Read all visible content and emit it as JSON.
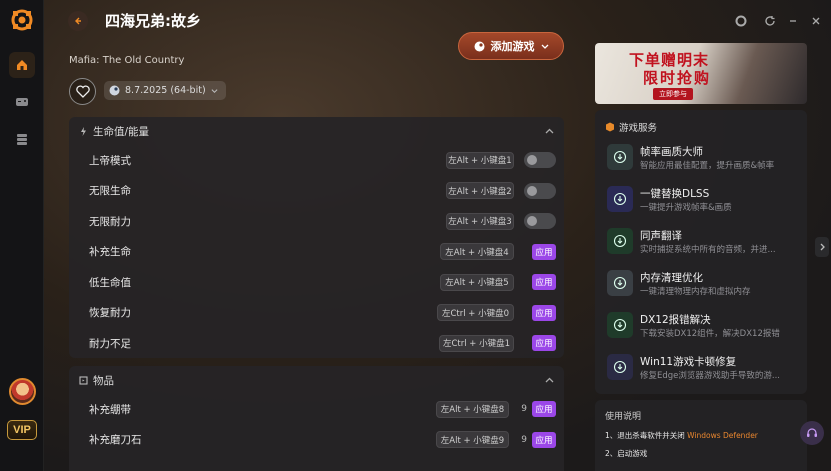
{
  "app": {
    "game_title": "四海兄弟:故乡",
    "game_subtitle": "Mafia: The Old Country",
    "add_game_label": "添加游戏",
    "version": "8.7.2025 (64-bit)",
    "vip_label": "VIP"
  },
  "cheats": {
    "section1_title": "生命值/能量",
    "section2_title": "物品",
    "apply_label": "应用",
    "rows": [
      {
        "label": "上帝模式",
        "hotkey": "左Alt + 小键盘1",
        "control": "toggle"
      },
      {
        "label": "无限生命",
        "hotkey": "左Alt + 小键盘2",
        "control": "toggle"
      },
      {
        "label": "无限耐力",
        "hotkey": "左Alt + 小键盘3",
        "control": "toggle"
      },
      {
        "label": "补充生命",
        "hotkey": "左Alt + 小键盘4",
        "control": "apply"
      },
      {
        "label": "低生命值",
        "hotkey": "左Alt + 小键盘5",
        "control": "apply"
      },
      {
        "label": "恢复耐力",
        "hotkey": "左Ctrl + 小键盘0",
        "control": "apply"
      },
      {
        "label": "耐力不足",
        "hotkey": "左Ctrl + 小键盘1",
        "control": "apply"
      }
    ],
    "items": [
      {
        "label": "补充绷带",
        "hotkey": "左Alt + 小键盘8",
        "count": "9",
        "control": "apply"
      },
      {
        "label": "补充磨刀石",
        "hotkey": "左Alt + 小键盘9",
        "count": "9",
        "control": "apply"
      }
    ]
  },
  "banner": {
    "line1": "下单赠明末",
    "line2": "限时抢购",
    "button": "立即参与"
  },
  "services": {
    "title": "游戏服务",
    "items": [
      {
        "title": "帧率画质大师",
        "desc": "智能应用最佳配置，提升画质&帧率",
        "color": "#2f3a3a"
      },
      {
        "title": "一键替换DLSS",
        "desc": "一键提升游戏帧率&画质",
        "color": "#2a2a55"
      },
      {
        "title": "同声翻译",
        "desc": "实时捕捉系统中所有的音频，并进...",
        "color": "#1f3b2a"
      },
      {
        "title": "内存清理优化",
        "desc": "一键清理物理内存和虚拟内存",
        "color": "#3a3f44"
      },
      {
        "title": "DX12报错解决",
        "desc": "下载安装DX12组件，解决DX12报错",
        "color": "#1f3b2a"
      },
      {
        "title": "Win11游戏卡顿修复",
        "desc": "修复Edge浏览器游戏助手导致的游...",
        "color": "#2a2a44"
      }
    ]
  },
  "usage": {
    "title": "使用说明",
    "step1_prefix": "1、退出杀毒软件并关闭",
    "step1_highlight": "Windows Defender",
    "step2": "2、启动游戏"
  }
}
